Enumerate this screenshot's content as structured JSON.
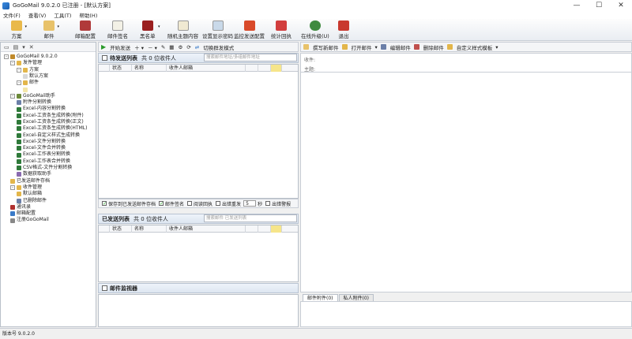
{
  "window": {
    "title": "GoGoMail 9.0.2.0   已注册 - [默认方案]",
    "min": "—",
    "max": "☐",
    "close": "✕"
  },
  "menu": [
    "文件(F)",
    "查看(V)",
    "工具(T)",
    "帮助(H)"
  ],
  "toolbar": {
    "scheme": "方案",
    "mail": "邮件",
    "mail_config": "邮箱配置",
    "mail_sign": "邮件签名",
    "blacklist": "黑名单",
    "random": "随机主题内容",
    "monitor": "设置显示密码",
    "monitor_send": "监控发送配置",
    "stats": "统计回执",
    "online_upgrade": "在线升级(U)",
    "exit": "退出"
  },
  "left_tree": [
    {
      "label": "GoGoMail 9.0.2.0",
      "level": 0,
      "box": "-",
      "color": "#c08a2b"
    },
    {
      "label": "发件管理",
      "level": 1,
      "box": "-",
      "color": "#e3b64a"
    },
    {
      "label": "方案",
      "level": 2,
      "box": "-",
      "color": "#e3b64a"
    },
    {
      "label": "默认方案",
      "level": 3,
      "box": "",
      "color": "#d9d9d9"
    },
    {
      "label": "邮件",
      "level": 2,
      "box": "-",
      "color": "#e3b64a"
    },
    {
      "label": "",
      "level": 3,
      "box": "",
      "color": "#f4e6a8"
    },
    {
      "label": "GoGoMail助手",
      "level": 1,
      "box": "-",
      "color": "#6c8a3a"
    },
    {
      "label": "附件分割转换",
      "level": 2,
      "box": "",
      "color": "#6b7fa8"
    },
    {
      "label": "Excel-内容分割转换",
      "level": 2,
      "box": "",
      "color": "#2f7a3a"
    },
    {
      "label": "Excel-工资条生成转换(附件)",
      "level": 2,
      "box": "",
      "color": "#2f7a3a"
    },
    {
      "label": "Excel-工资条生成转换(正文)",
      "level": 2,
      "box": "",
      "color": "#2f7a3a"
    },
    {
      "label": "Excel-工资条生成转换(HTML)",
      "level": 2,
      "box": "",
      "color": "#2f7a3a"
    },
    {
      "label": "Excel-自定义样式生成转换",
      "level": 2,
      "box": "",
      "color": "#2f7a3a"
    },
    {
      "label": "Excel-文件分割转换",
      "level": 2,
      "box": "",
      "color": "#2f7a3a"
    },
    {
      "label": "Excel-文件合并转换",
      "level": 2,
      "box": "",
      "color": "#2f7a3a"
    },
    {
      "label": "Excel-工作表分割转换",
      "level": 2,
      "box": "",
      "color": "#2f7a3a"
    },
    {
      "label": "Excel-工作表合并转换",
      "level": 2,
      "box": "",
      "color": "#2f7a3a"
    },
    {
      "label": "CSV格式-文件分割转换",
      "level": 2,
      "box": "",
      "color": "#2f7a3a"
    },
    {
      "label": "数据获取助手",
      "level": 2,
      "box": "",
      "color": "#8a6ab0"
    },
    {
      "label": "已发送邮件存档",
      "level": 1,
      "box": "",
      "color": "#e3b64a"
    },
    {
      "label": "收件管理",
      "level": 1,
      "box": "-",
      "color": "#e3b64a"
    },
    {
      "label": "默认邮箱",
      "level": 2,
      "box": "",
      "color": "#e3b64a"
    },
    {
      "label": "已删除邮件",
      "level": 2,
      "box": "",
      "color": "#6b7fa8"
    },
    {
      "label": "通讯录",
      "level": 1,
      "box": "",
      "color": "#b03030"
    },
    {
      "label": "邮箱配置",
      "level": 1,
      "box": "",
      "color": "#3a7ac8"
    },
    {
      "label": "注册GoGoMail",
      "level": 1,
      "box": "",
      "color": "#888888"
    }
  ],
  "mid": {
    "start_send": "开始发送",
    "switch_mode": "切换群发模式",
    "pending_title": "待发送列表",
    "pending_count": "共 0 位收件人",
    "pending_search": "搜索邮件地址/多组邮件地址",
    "columns": [
      "状态",
      "名称",
      "收件人邮箱"
    ],
    "opts": {
      "save_archive": "保存到已发送邮件存档",
      "mail_sign": "邮件签名",
      "read_receipt": "阅读回执",
      "interval": "出错重发",
      "interval_val": "5",
      "seconds": "秒",
      "alert": "出错警报"
    },
    "sent_title": "已发送列表",
    "sent_count": "共 0 位收件人",
    "sent_search": "搜索邮件 已发送列表",
    "monitor": "邮件监视器"
  },
  "right": {
    "tools": [
      "撰写新邮件",
      "打开邮件",
      "编辑邮件",
      "删除邮件",
      "自定义样式模板"
    ],
    "to_label": "收件:",
    "subject_label": "主题:",
    "tabs": [
      "邮件附件(0)",
      "私人附件(0)"
    ]
  },
  "status": "版本号 9.0.2.0"
}
